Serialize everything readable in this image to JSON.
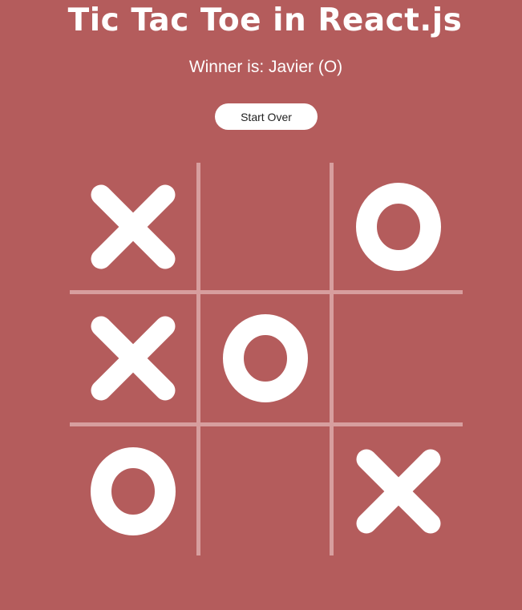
{
  "header": {
    "title": "Tic Tac Toe in React.js"
  },
  "status": {
    "text": "Winner is: Javier (O)"
  },
  "controls": {
    "restart_label": "Start Over"
  },
  "board": {
    "cells": [
      "X",
      "",
      "O",
      "X",
      "O",
      "",
      "O",
      "",
      "X"
    ]
  },
  "colors": {
    "background": "#b45c5c",
    "grid": "#d79e9e",
    "mark": "#ffffff",
    "button_bg": "#ffffff",
    "button_text": "#222222"
  }
}
